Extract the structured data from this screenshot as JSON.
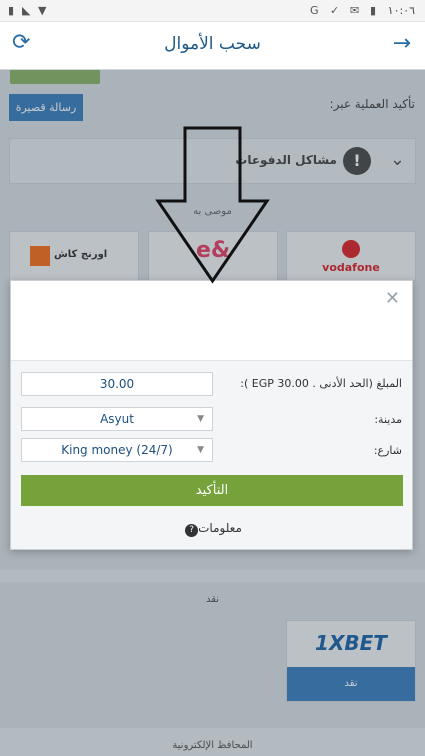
{
  "status_bar": {
    "time": "١٠:٠٦",
    "icons": [
      "notification-icon",
      "signal-icon",
      "wifi-icon",
      "google-icon",
      "check-icon",
      "mail-icon",
      "battery-icon"
    ]
  },
  "app_bar": {
    "title": "سحب الأموال",
    "back_icon": "arrow-right-icon",
    "refresh_icon": "refresh-icon"
  },
  "background": {
    "confirm_via_label": "تأكيد العملية عبر:",
    "sms_button": "رسالة قصيرة",
    "payment_issues": "مشاكل الدفوعات",
    "recommended_label": "موصى به",
    "tiles": [
      {
        "name": "vodafone",
        "label": "vodafone"
      },
      {
        "name": "etisalat-cash",
        "label": "e&"
      },
      {
        "name": "orange-cash",
        "label": "اورنج كاش"
      }
    ],
    "cash_label": "نقد",
    "xbet_logo": "1XBET",
    "xbet_caption": "نقد",
    "ewallets_label": "المحافظ الإلكترونية"
  },
  "modal": {
    "amount_label": "المبلغ (الحد الأدنى . EGP 30.00 ):",
    "amount_value": "30.00",
    "city_label": "مدينة:",
    "city_value": "Asyut",
    "street_label": "شارع:",
    "street_value": "King money (24/7)",
    "confirm_button": "التأكيد",
    "info_link": "معلومات"
  },
  "colors": {
    "accent_blue": "#2a6ea8",
    "confirm_green": "#75a23a",
    "vodafone_red": "#d8262b"
  }
}
